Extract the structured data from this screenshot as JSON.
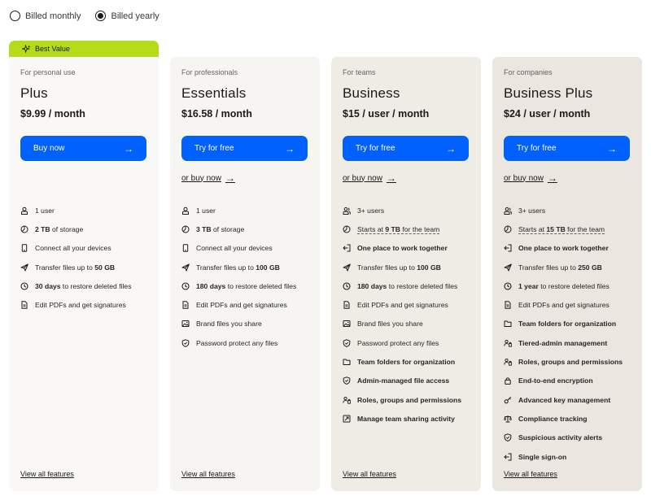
{
  "billing": {
    "monthly_label": "Billed monthly",
    "yearly_label": "Billed yearly",
    "selected": "yearly"
  },
  "badge": {
    "label": "Best Value",
    "color": "#b4dc19"
  },
  "accent_color": "#0061fe",
  "plans": [
    {
      "audience": "For personal use",
      "name": "Plus",
      "price": "$9.99 / month",
      "cta": "Buy now",
      "features": [
        {
          "icon": "user-icon",
          "parts": [
            {
              "t": "1 user"
            }
          ]
        },
        {
          "icon": "storage-icon",
          "parts": [
            {
              "t": "2 TB",
              "b": true
            },
            {
              "t": " of storage"
            }
          ]
        },
        {
          "icon": "device-icon",
          "parts": [
            {
              "t": "Connect all your devices"
            }
          ]
        },
        {
          "icon": "send-icon",
          "parts": [
            {
              "t": "Transfer files up to "
            },
            {
              "t": "50 GB",
              "b": true
            }
          ]
        },
        {
          "icon": "restore-icon",
          "parts": [
            {
              "t": "30 days",
              "b": true
            },
            {
              "t": " to restore deleted files"
            }
          ]
        },
        {
          "icon": "pdf-icon",
          "parts": [
            {
              "t": "Edit PDFs and get signatures"
            }
          ]
        }
      ],
      "view_all": "View all features"
    },
    {
      "audience": "For professionals",
      "name": "Essentials",
      "price": "$16.58 / month",
      "cta": "Try for free",
      "secondary": "or buy now",
      "features": [
        {
          "icon": "user-icon",
          "parts": [
            {
              "t": "1 user"
            }
          ]
        },
        {
          "icon": "storage-icon",
          "parts": [
            {
              "t": "3 TB",
              "b": true
            },
            {
              "t": " of storage"
            }
          ]
        },
        {
          "icon": "device-icon",
          "parts": [
            {
              "t": "Connect all your devices"
            }
          ]
        },
        {
          "icon": "send-icon",
          "parts": [
            {
              "t": "Transfer files up to "
            },
            {
              "t": "100 GB",
              "b": true
            }
          ]
        },
        {
          "icon": "restore-icon",
          "parts": [
            {
              "t": "180 days",
              "b": true
            },
            {
              "t": " to restore deleted files"
            }
          ]
        },
        {
          "icon": "pdf-icon",
          "parts": [
            {
              "t": "Edit PDFs and get signatures"
            }
          ]
        },
        {
          "icon": "image-icon",
          "parts": [
            {
              "t": "Brand files you share"
            }
          ]
        },
        {
          "icon": "shield-icon",
          "parts": [
            {
              "t": "Password protect any files"
            }
          ]
        }
      ],
      "view_all": "View all features"
    },
    {
      "audience": "For teams",
      "name": "Business",
      "price": "$15 / user / month",
      "cta": "Try for free",
      "secondary": "or buy now",
      "features": [
        {
          "icon": "users-icon",
          "parts": [
            {
              "t": "3+ users"
            }
          ]
        },
        {
          "icon": "storage-icon",
          "dotted": true,
          "parts": [
            {
              "t": "Starts at "
            },
            {
              "t": "9 TB",
              "b": true
            },
            {
              "t": " for the team"
            }
          ]
        },
        {
          "icon": "login-icon",
          "parts": [
            {
              "t": "One place to work together",
              "b": true
            }
          ]
        },
        {
          "icon": "send-icon",
          "parts": [
            {
              "t": "Transfer files up to "
            },
            {
              "t": "100 GB",
              "b": true
            }
          ]
        },
        {
          "icon": "restore-icon",
          "parts": [
            {
              "t": "180 days",
              "b": true
            },
            {
              "t": " to restore deleted files"
            }
          ]
        },
        {
          "icon": "pdf-icon",
          "parts": [
            {
              "t": "Edit PDFs and get signatures"
            }
          ]
        },
        {
          "icon": "image-icon",
          "parts": [
            {
              "t": "Brand files you share"
            }
          ]
        },
        {
          "icon": "shield-icon",
          "parts": [
            {
              "t": "Password protect any files"
            }
          ]
        },
        {
          "icon": "folder-icon",
          "parts": [
            {
              "t": "Team folders for organization",
              "b": true
            }
          ]
        },
        {
          "icon": "shield-check-icon",
          "parts": [
            {
              "t": "Admin-managed file access",
              "b": true
            }
          ]
        },
        {
          "icon": "roles-icon",
          "parts": [
            {
              "t": "Roles, groups and permissions",
              "b": true
            }
          ]
        },
        {
          "icon": "share-activity-icon",
          "parts": [
            {
              "t": "Manage team sharing activity",
              "b": true
            }
          ]
        }
      ],
      "view_all": "View all features"
    },
    {
      "audience": "For companies",
      "name": "Business Plus",
      "price": "$24 / user / month",
      "cta": "Try for free",
      "secondary": "or buy now",
      "features": [
        {
          "icon": "users-icon",
          "parts": [
            {
              "t": "3+ users"
            }
          ]
        },
        {
          "icon": "storage-icon",
          "dotted": true,
          "parts": [
            {
              "t": "Starts at "
            },
            {
              "t": "15 TB",
              "b": true
            },
            {
              "t": " for the team"
            }
          ]
        },
        {
          "icon": "login-icon",
          "parts": [
            {
              "t": "One place to work together",
              "b": true
            }
          ]
        },
        {
          "icon": "send-icon",
          "parts": [
            {
              "t": "Transfer files up to "
            },
            {
              "t": "250 GB",
              "b": true
            }
          ]
        },
        {
          "icon": "restore-icon",
          "parts": [
            {
              "t": "1 year",
              "b": true
            },
            {
              "t": " to restore deleted files"
            }
          ]
        },
        {
          "icon": "pdf-icon",
          "parts": [
            {
              "t": "Edit PDFs and get signatures"
            }
          ]
        },
        {
          "icon": "folder-icon",
          "parts": [
            {
              "t": "Team folders for organization",
              "b": true
            }
          ]
        },
        {
          "icon": "roles-icon",
          "parts": [
            {
              "t": "Tiered-admin management",
              "b": true
            }
          ]
        },
        {
          "icon": "roles-icon",
          "parts": [
            {
              "t": "Roles, groups and permissions",
              "b": true
            }
          ]
        },
        {
          "icon": "lock-icon",
          "parts": [
            {
              "t": "End-to-end encryption",
              "b": true
            }
          ]
        },
        {
          "icon": "key-icon",
          "parts": [
            {
              "t": "Advanced key management",
              "b": true
            }
          ]
        },
        {
          "icon": "scale-icon",
          "parts": [
            {
              "t": "Compliance tracking",
              "b": true
            }
          ]
        },
        {
          "icon": "shield-check-icon",
          "parts": [
            {
              "t": "Suspicious activity alerts",
              "b": true
            }
          ]
        },
        {
          "icon": "login-icon",
          "parts": [
            {
              "t": "Single sign-on",
              "b": true
            }
          ]
        }
      ],
      "view_all": "View all features"
    }
  ]
}
